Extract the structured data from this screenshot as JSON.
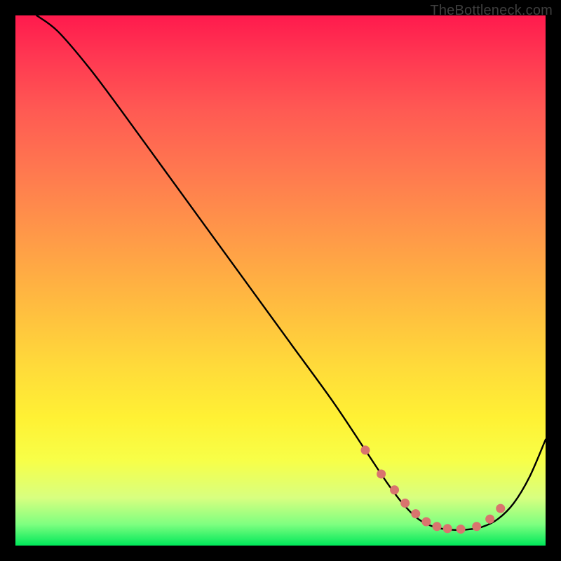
{
  "watermark": "TheBottleneck.com",
  "chart_data": {
    "type": "line",
    "title": "",
    "xlabel": "",
    "ylabel": "",
    "xlim": [
      0,
      100
    ],
    "ylim": [
      0,
      100
    ],
    "series": [
      {
        "name": "bottleneck-curve",
        "x": [
          4,
          8,
          14,
          20,
          28,
          36,
          44,
          52,
          60,
          66,
          70,
          73,
          76,
          79,
          82,
          85,
          88,
          91,
          94,
          97,
          100
        ],
        "y": [
          100,
          97,
          90,
          82,
          71,
          60,
          49,
          38,
          27,
          18,
          12,
          8,
          5,
          3.5,
          3,
          3,
          3.5,
          5,
          8,
          13,
          20
        ]
      }
    ],
    "markers": {
      "name": "trough-dots",
      "x": [
        66,
        69,
        71.5,
        73.5,
        75.5,
        77.5,
        79.5,
        81.5,
        84,
        87,
        89.5,
        91.5
      ],
      "y": [
        18,
        13.5,
        10.5,
        8,
        6,
        4.5,
        3.6,
        3.2,
        3.1,
        3.6,
        5,
        7
      ]
    },
    "gradient_stops": [
      {
        "pos": 0,
        "color": "#ff1a4d"
      },
      {
        "pos": 18,
        "color": "#ff5a53"
      },
      {
        "pos": 42,
        "color": "#ff9a48"
      },
      {
        "pos": 66,
        "color": "#ffda3a"
      },
      {
        "pos": 84,
        "color": "#f7ff48"
      },
      {
        "pos": 96,
        "color": "#7eff80"
      },
      {
        "pos": 100,
        "color": "#00e85a"
      }
    ]
  }
}
